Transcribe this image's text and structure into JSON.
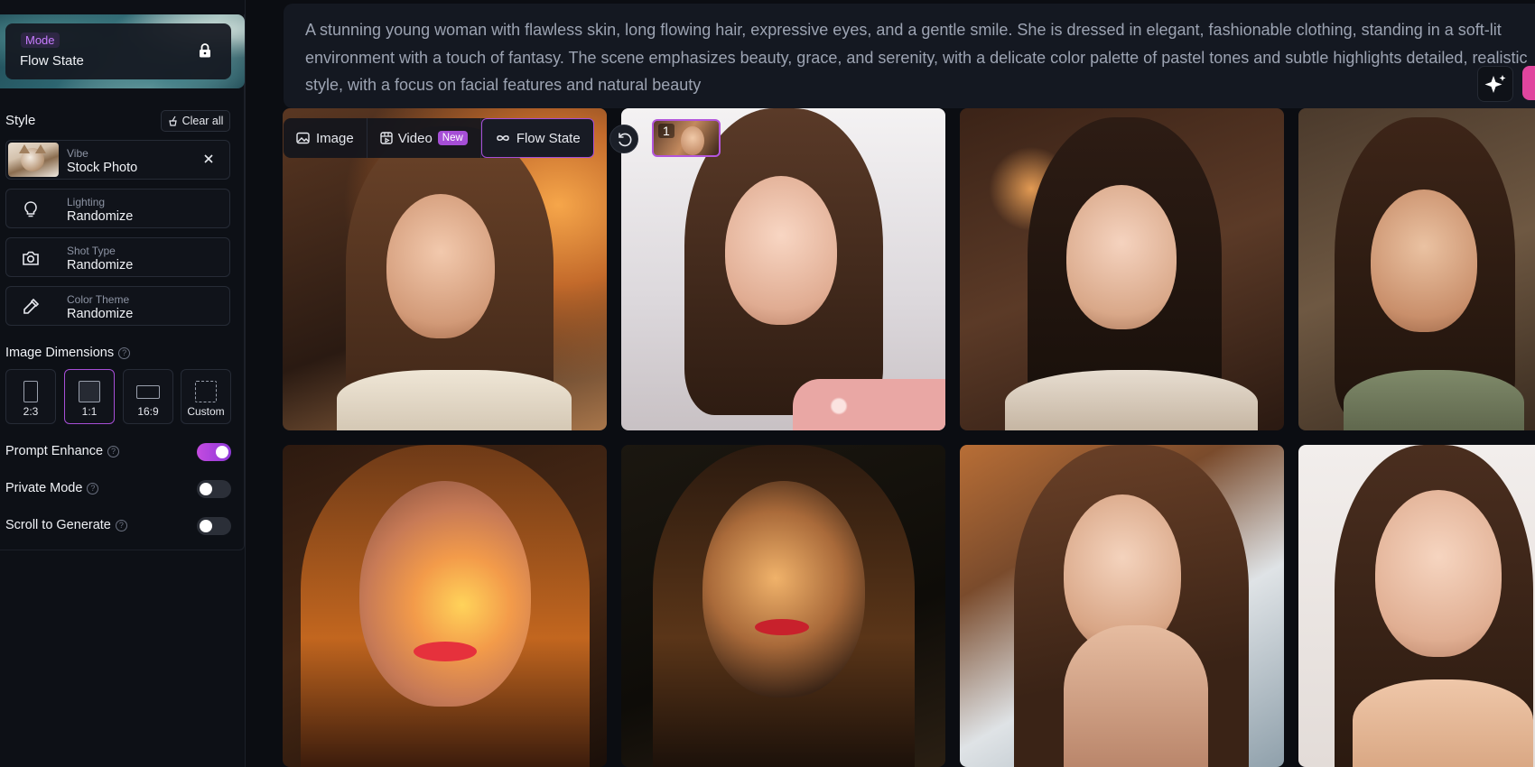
{
  "mode": {
    "label": "Mode",
    "value": "Flow State"
  },
  "style": {
    "title": "Style",
    "clear_label": "Clear all",
    "options": [
      {
        "label": "Vibe",
        "value": "Stock Photo"
      },
      {
        "label": "Lighting",
        "value": "Randomize"
      },
      {
        "label": "Shot Type",
        "value": "Randomize"
      },
      {
        "label": "Color Theme",
        "value": "Randomize"
      }
    ]
  },
  "dimensions": {
    "title": "Image Dimensions",
    "options": [
      {
        "label": "2:3",
        "selected": false
      },
      {
        "label": "1:1",
        "selected": true
      },
      {
        "label": "16:9",
        "selected": false
      },
      {
        "label": "Custom",
        "selected": false
      }
    ]
  },
  "toggles": [
    {
      "label": "Prompt Enhance",
      "on": true
    },
    {
      "label": "Private Mode",
      "on": false
    },
    {
      "label": "Scroll to Generate",
      "on": false
    }
  ],
  "prompt": {
    "text": "A stunning young woman with flawless skin, long flowing hair, expressive eyes, and a gentle smile. She is dressed in elegant, fashionable clothing, standing in a soft-lit environment with a touch of fantasy. The scene emphasizes beauty, grace, and serenity, with a delicate color palette of pastel tones and subtle highlights detailed, realistic style, with a focus on facial features and natural beauty"
  },
  "tabs": [
    {
      "label": "Image",
      "icon": "image-icon"
    },
    {
      "label": "Video",
      "icon": "video-icon",
      "badge": "New"
    },
    {
      "label": "Flow State",
      "icon": "infinity-icon",
      "active": true
    }
  ],
  "queue": {
    "count": "1"
  },
  "colors": {
    "accent": "#a64ed6",
    "generate": "#e0459e"
  }
}
